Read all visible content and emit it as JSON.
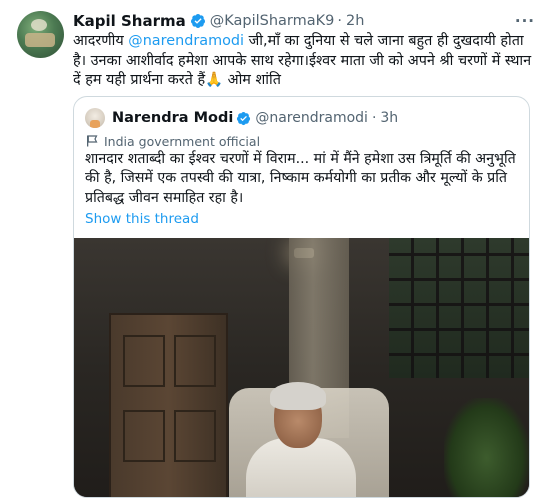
{
  "tweet": {
    "author_name": "Kapil Sharma",
    "author_handle": "@KapilSharmaK9",
    "separator": "·",
    "time": "2h",
    "more_label": "···",
    "text_before_mention": "आदरणीय ",
    "mention": "@narendramodi",
    "text_after_mention": " जी,माँ का दुनिया से चले जाना बहुत ही दुखदायी होता है। उनका आशीर्वाद हमेशा आपके साथ रहेगा।ईश्वर माता जी को अपने श्री चरणों में स्थान दें हम यही प्रार्थना करते हैं🙏 ओम शांति"
  },
  "quoted": {
    "author_name": "Narendra Modi",
    "author_handle": "@narendramodi",
    "separator": "·",
    "time": "3h",
    "label": "India government official",
    "text": "शानदार शताब्दी का ईश्वर चरणों में विराम... मां में मैंने हमेशा उस त्रिमूर्ति की अनुभूति की है, जिसमें एक तपस्वी की यात्रा, निष्काम कर्मयोगी का प्रतीक और मूल्यों के प्रति प्रतिबद्ध जीवन समाहित रहा है।",
    "show_thread": "Show this thread"
  },
  "colors": {
    "link": "#1d9bf0",
    "verified": "#1d9bf0",
    "secondary_text": "#536471",
    "border": "#cfd9de"
  },
  "icons": {
    "verified": "verified-badge-icon",
    "more": "more-icon",
    "government_label": "flag-icon"
  }
}
